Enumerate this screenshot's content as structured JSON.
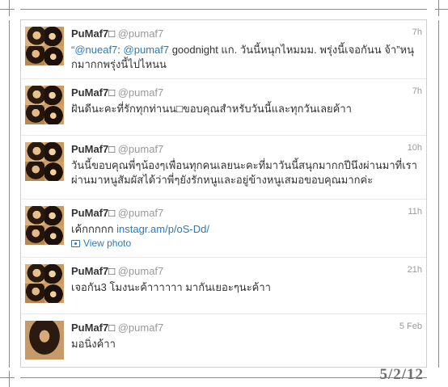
{
  "tweets": [
    {
      "name": "PuMaf7",
      "name_glyph": "□",
      "handle": "@pumaf7",
      "time": "7h",
      "parts": [
        {
          "t": "mention",
          "v": "“@nueaf7"
        },
        {
          "t": "text",
          "v": ": "
        },
        {
          "t": "mention",
          "v": "@pumaf7"
        },
        {
          "t": "text",
          "v": " goodnight แก. วันนี้หนุกไหมมม. พรุ่งนี้เจอกันน จ้า”หนุกมากกพรุ่งนี้ไปไหนน"
        }
      ]
    },
    {
      "name": "PuMaf7",
      "name_glyph": "□",
      "handle": "@pumaf7",
      "time": "7h",
      "parts": [
        {
          "t": "text",
          "v": "ฝันดีนะคะที่รักทุกท่านน□ขอบคุณสำหรับวันนี้และทุกวันเลยค้าา"
        }
      ]
    },
    {
      "name": "PuMaf7",
      "name_glyph": "□",
      "handle": "@pumaf7",
      "time": "10h",
      "parts": [
        {
          "t": "text",
          "v": "วันนี้ขอบคุณพี่ๆน้องๆเพื่อนทุกคนเลยนะคะที่มาวันนี้สนุกมากกปีนึงผ่านมาที่เราผ่านมาหนูสัมผัสได้ว่าพี่ๆยังรักหนูและอยู่ข้างหนูเสมอขอบคุณมากค่ะ"
        }
      ]
    },
    {
      "name": "PuMaf7",
      "name_glyph": "□",
      "handle": "@pumaf7",
      "time": "11h",
      "parts": [
        {
          "t": "text",
          "v": "เค้กกกกก "
        },
        {
          "t": "link",
          "v": "instagr.am/p/oS-Dd/"
        }
      ],
      "view_photo": "View photo"
    },
    {
      "name": "PuMaf7",
      "name_glyph": "□",
      "handle": "@pumaf7",
      "time": "21h",
      "parts": [
        {
          "t": "text",
          "v": "เจอกัน3 โมงนะค้าาาาาา มากันเยอะๆนะค้าา"
        }
      ]
    },
    {
      "name": "PuMaf7",
      "name_glyph": "□",
      "handle": "@pumaf7",
      "time": "5 Feb",
      "parts": [
        {
          "t": "text",
          "v": "มอนิ่งค้าา"
        }
      ]
    }
  ],
  "date_stamp": "5/2/12"
}
